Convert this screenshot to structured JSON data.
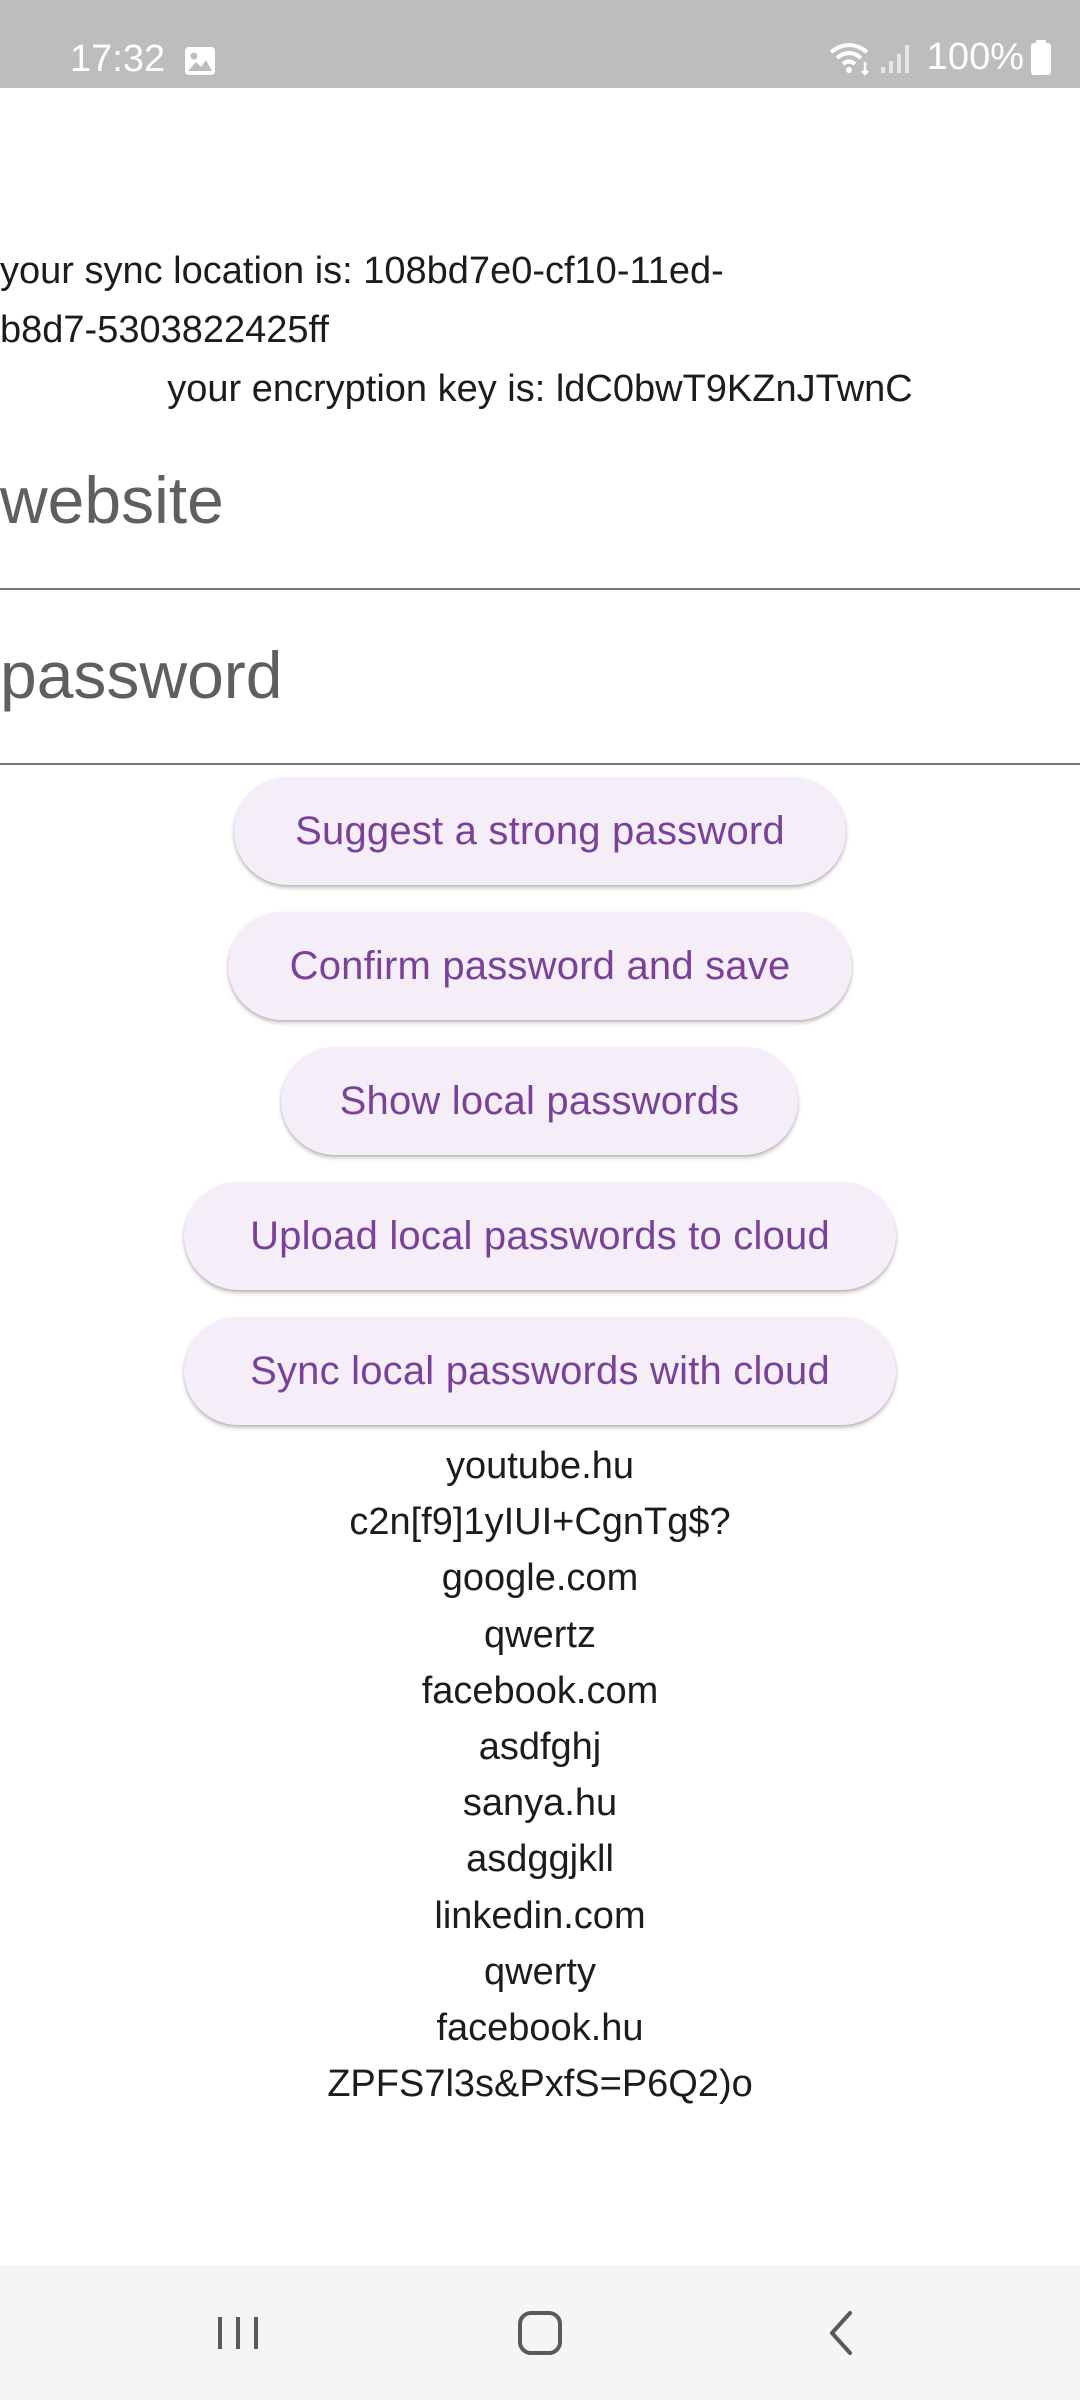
{
  "status_bar": {
    "time": "17:32",
    "battery": "100%",
    "icons": [
      "gallery-icon",
      "wifi-icon",
      "signal-icon",
      "battery-icon"
    ]
  },
  "info": {
    "sync_location": "your sync location is: 108bd7e0-cf10-11ed-b8d7-5303822425ff",
    "encryption_key": "your encryption key is: ldC0bwT9KZnJTwnC"
  },
  "form": {
    "website_label": "website",
    "password_label": "password"
  },
  "buttons": {
    "suggest": "Suggest a strong password",
    "confirm": "Confirm password and save",
    "show_local": "Show local passwords",
    "upload": "Upload local passwords to cloud",
    "sync": "Sync local passwords with cloud"
  },
  "entries": [
    "youtube.hu",
    "c2n[f9]1yIUI+CgnTg$?",
    "google.com",
    "qwertz",
    "facebook.com",
    "asdfghj",
    "sanya.hu",
    "asdggjkll",
    "linkedin.com",
    "qwerty",
    "facebook.hu",
    "ZPFS7l3s&PxfS=P6Q2)o"
  ],
  "nav_bar": {
    "icons": [
      "recents-icon",
      "home-icon",
      "back-icon"
    ]
  },
  "colors": {
    "accent": "#7a4199",
    "button_bg": "#f5eef9",
    "status_bar_bg": "#bdbdbd"
  }
}
